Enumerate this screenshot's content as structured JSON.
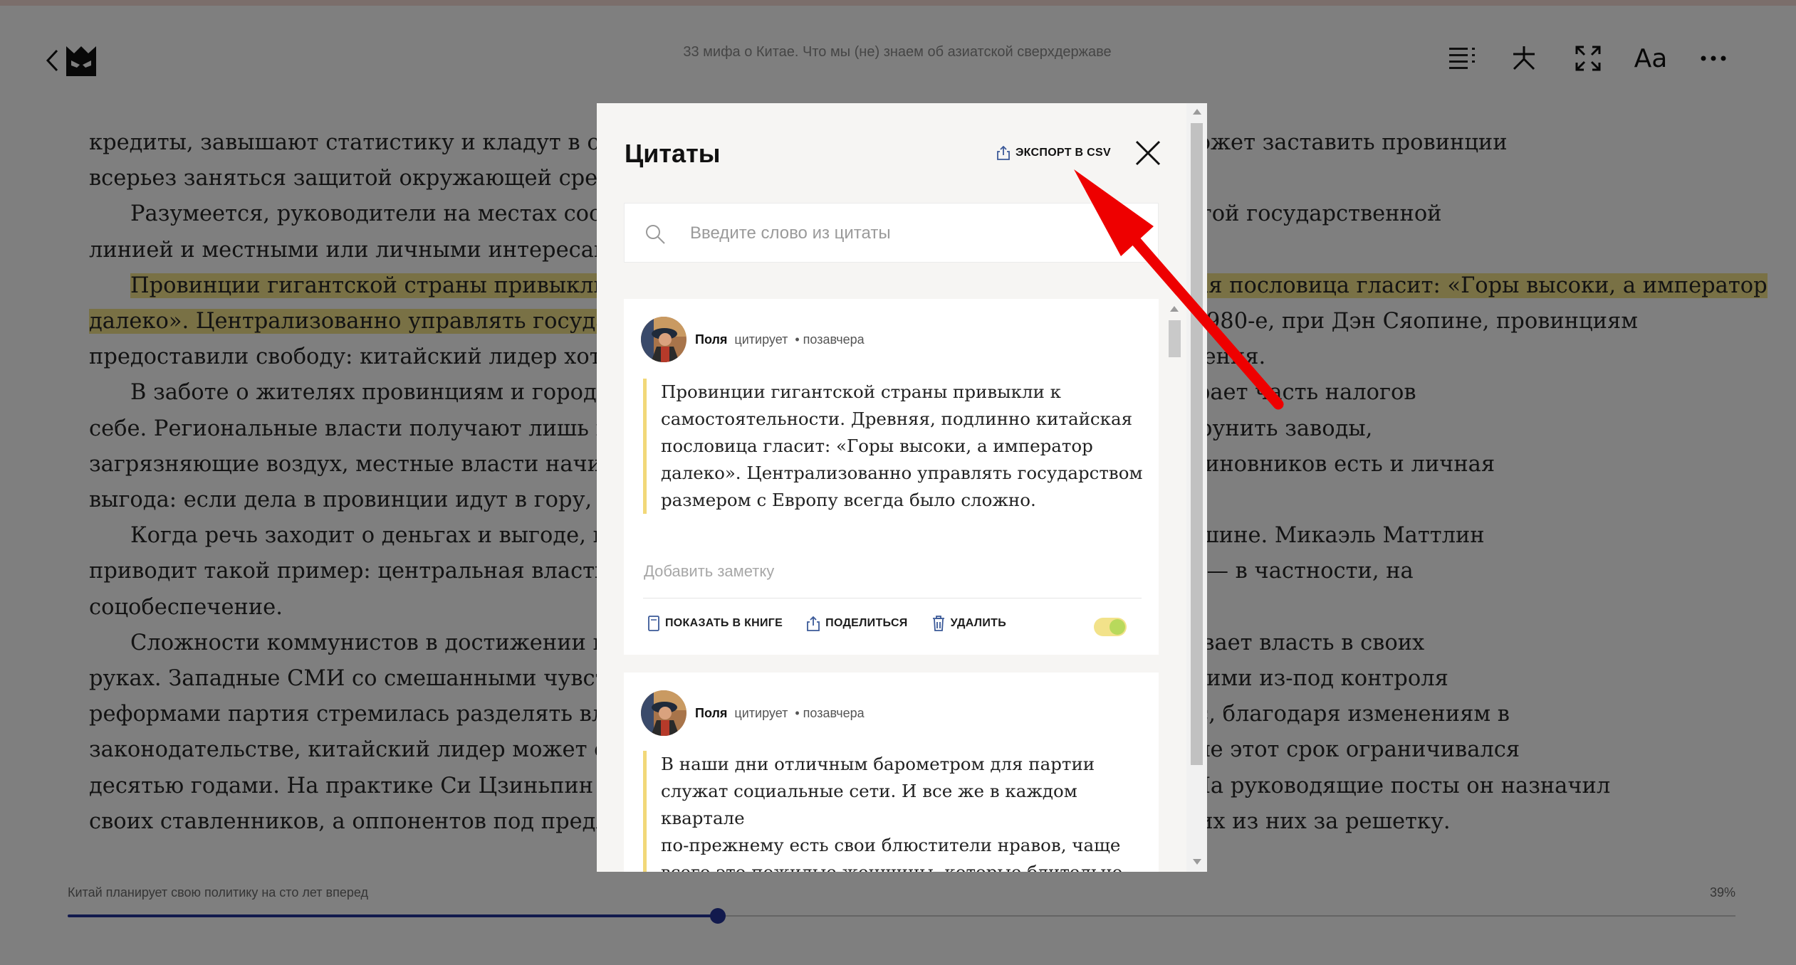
{
  "reader": {
    "book_title": "33 мифа о Китае. Что мы (не) знаем об азиатской сверхдержаве",
    "text": {
      "l1": "кредиты, завышают статистику и кладут в свой карман крупные суммы. К примеру, никак не может заставить провинции",
      "l2": "всерьез заняться защитой окружающей среды.",
      "l3": "Разумеется, руководители на местах состоят в партии и вынуждены лавировать между строгой государственной",
      "l4": "линией и местными или личными интересами.",
      "l5": "Провинции гигантской страны привыкли к самостоятельности. Древняя, подлинно китайская пословица гласит: «Горы высоки, а император",
      "l6a": "далеко». Централизованно управлять государством размером с Европу всегда было сложно.",
      "l6b": " В 1980-е, при Дэн Сяопине, провинциям",
      "l7": "предоставили свободу: китайский лидер хотел, чтобы часть людей достигла богатства и обогащения.",
      "l8": "В заботе о жителях провинциям и городам отводится особая роль: центральная власть забирает часть налогов",
      "l9": "себе. Региональные власти получают лишь половину своих доходов. Когда центр требует приструнить заводы,",
      "l10": "загрязняющие воздух, местные власти начинают опасаться за экономику региона. В этом для чиновников есть и личная",
      "l11": "выгода: если дела в провинции идут в гору, можно ждать продвижения.",
      "l12": "Когда речь заходит о деньгах и выгоде, крупные регионы противостоят государственной машине. Микаэль Маттлин",
      "l13": "приводит такой пример: центральная власть готова перераспределять прибыли на общее благо — в частности, на",
      "l14": "соцобеспечение.",
      "l15": "Сложности коммунистов в достижении целей объясняют, почему Си Цзиньпин сосредоточивает власть в своих",
      "l16": "руках. Западные СМИ со смешанными чувствами наблюдают: после Мао Цзэдуна с его вышедшими из-под контроля",
      "l17": "реформами партия стремилась разделять власть, чтобы избежать культа одного лидера. Сейчас, благодаря изменениям в",
      "l18": "законодательстве, китайский лидер может оставаться у власти сколько угодно, тогда как раньше этот срок ограничивался",
      "l19": "десятью годами. На практике Си Цзиньпин контролирует все аспекты политики и экономики. На руководящие посты он назначил",
      "l20": "своих ставленников, а оппонентов под предлогом борьбы с коррупцией устранил, упрятав многих из них за решетку."
    },
    "footer": {
      "chapter": "Китай планирует свою политику на сто лет вперед",
      "percent": "39%"
    },
    "progress": 0.39
  },
  "modal": {
    "title": "Цитаты",
    "export_label": "ЭКСПОРТ В CSV",
    "search_placeholder": "Введите слово из цитаты",
    "quotes": [
      {
        "user": "Поля",
        "verb": "цитирует",
        "time": "• позавчера",
        "lines": [
          "Провинции гигантской страны привыкли к",
          "самостоятельности. Древняя, подлинно китайская",
          "пословица гласит: «Горы высоки, а император",
          "далеко». Централизованно управлять государством",
          "размером с Европу всегда было сложно."
        ],
        "note_placeholder": "Добавить заметку",
        "actions": {
          "show": "ПОКАЗАТЬ В КНИГЕ",
          "share": "ПОДЕЛИТЬСЯ",
          "delete": "УДАЛИТЬ"
        }
      },
      {
        "user": "Поля",
        "verb": "цитирует",
        "time": "• позавчера",
        "lines": [
          "В наши дни отличным барометром для партии",
          "служат социальные сети. И все же в каждом квартале",
          "по-прежнему есть свои блюстители нравов, чаще",
          "всего это пожилые женщины, которые бдительно"
        ]
      }
    ]
  },
  "colors": {
    "accent": "#24349a",
    "highlight": "#f3e28a",
    "arrow": "#ee0000"
  }
}
